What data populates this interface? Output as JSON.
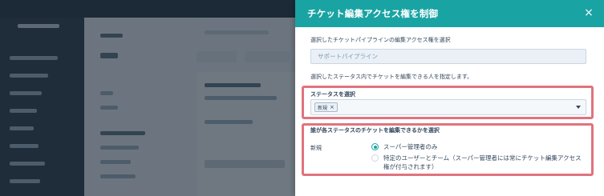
{
  "panel": {
    "title": "チケット編集アクセス権を制御",
    "close_label": "×",
    "pipeline_section": {
      "label": "選択したチケットパイプラインの編集アクセス権を選択",
      "value": "サポートパイプライン"
    },
    "instruction": "選択したステータス内でチケットを編集できる人を指定します。",
    "status_section": {
      "label": "ステータスを選択",
      "selected_tags": [
        "新規"
      ],
      "tag_remove_label": "×"
    },
    "permission_section": {
      "label": "誰が各ステータスのチケットを編集できるかを選択",
      "status_name": "新規",
      "options": [
        {
          "label": "スーパー管理者のみ",
          "checked": true
        },
        {
          "label": "特定のユーザーとチーム（スーパー管理者には常にチケット編集アクセス",
          "label_cont": "権が付与されます）",
          "checked": false
        }
      ]
    },
    "colors": {
      "header": "#1aa3a3",
      "highlight": "#e0737e"
    }
  }
}
